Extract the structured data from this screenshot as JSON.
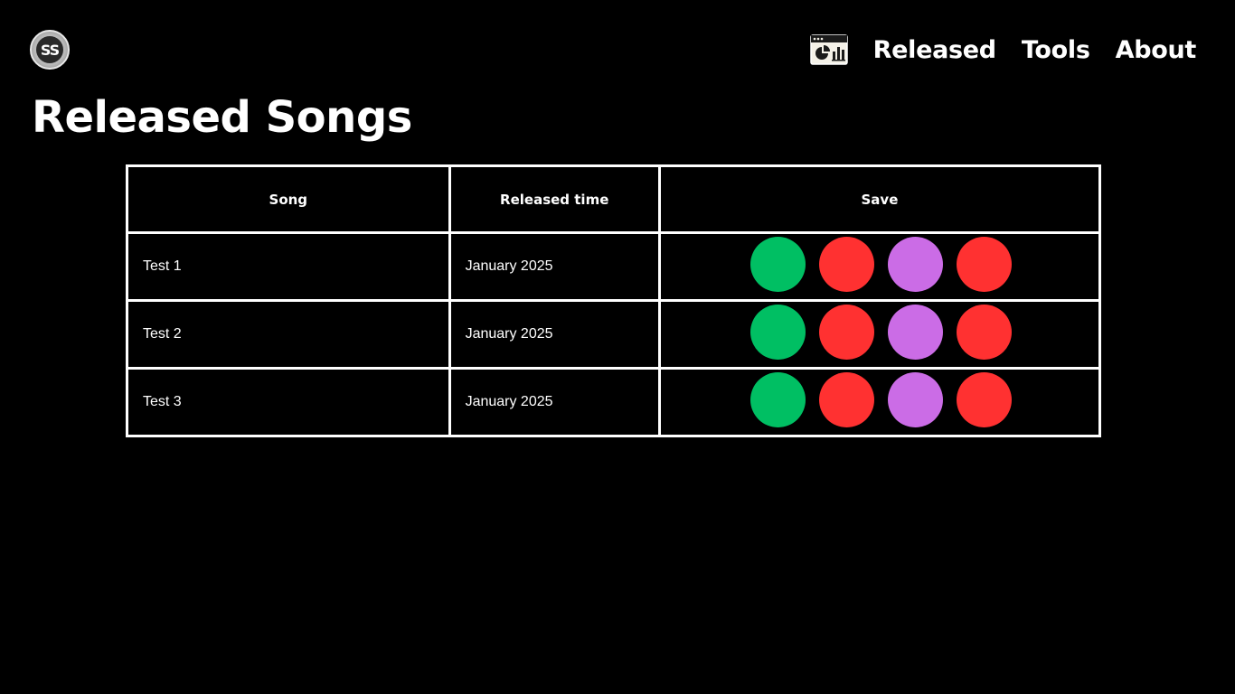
{
  "header": {
    "logo_text": "SS",
    "nav": {
      "icon": "dashboard-chart-icon",
      "items": [
        {
          "label": "Released"
        },
        {
          "label": "Tools"
        },
        {
          "label": "About"
        }
      ]
    }
  },
  "main": {
    "title": "Released Songs",
    "table": {
      "headers": {
        "song": "Song",
        "released_time": "Released time",
        "save": "Save"
      },
      "rows": [
        {
          "song": "Test 1",
          "released_time": "January 2025"
        },
        {
          "song": "Test 2",
          "released_time": "January 2025"
        },
        {
          "song": "Test 3",
          "released_time": "January 2025"
        }
      ],
      "save_button_colors": [
        "#00bf63",
        "#ff3131",
        "#cb6ce6",
        "#ff3131"
      ]
    }
  }
}
